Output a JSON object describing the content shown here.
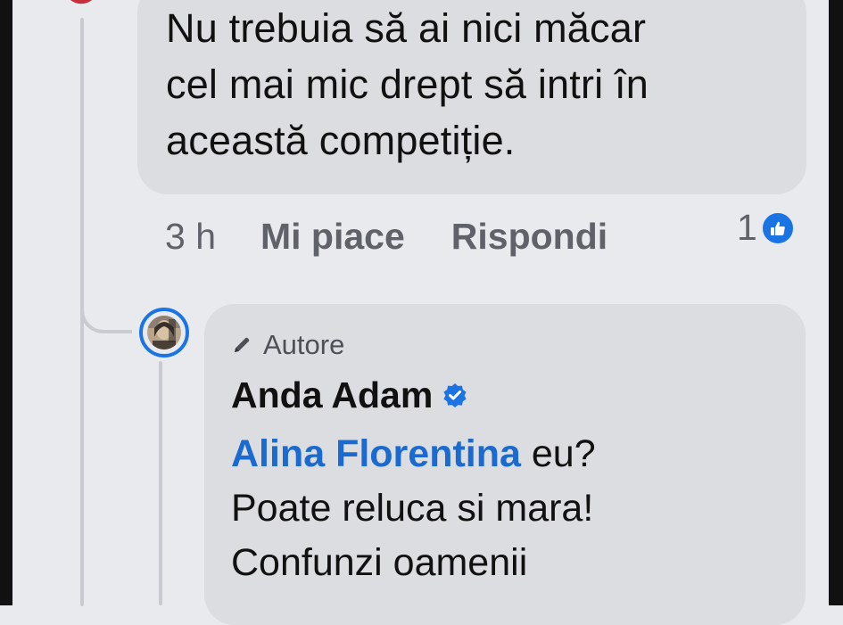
{
  "comment": {
    "lines": [
      "Nu trebuia să ai nici măcar",
      "cel mai mic drept să intri în",
      "această competiție."
    ],
    "time": "3 h",
    "like_label": "Mi piace",
    "reply_label": "Rispondi",
    "reaction_count": "1"
  },
  "reply": {
    "badge_label": "Autore",
    "author_name": "Anda Adam",
    "mention": "Alina Florentina",
    "first_line_rest": " eu?",
    "lines": [
      "Poate reluca si mara!",
      "Confunzi oamenii"
    ]
  },
  "colors": {
    "background": "#e9eaee",
    "bubble": "#dcdde1",
    "accent": "#1b74e4",
    "mention": "#1b6ad0",
    "muted_text": "#5f6268"
  },
  "icons": [
    "like-reaction-icon",
    "pencil-icon",
    "verified-badge-icon"
  ]
}
